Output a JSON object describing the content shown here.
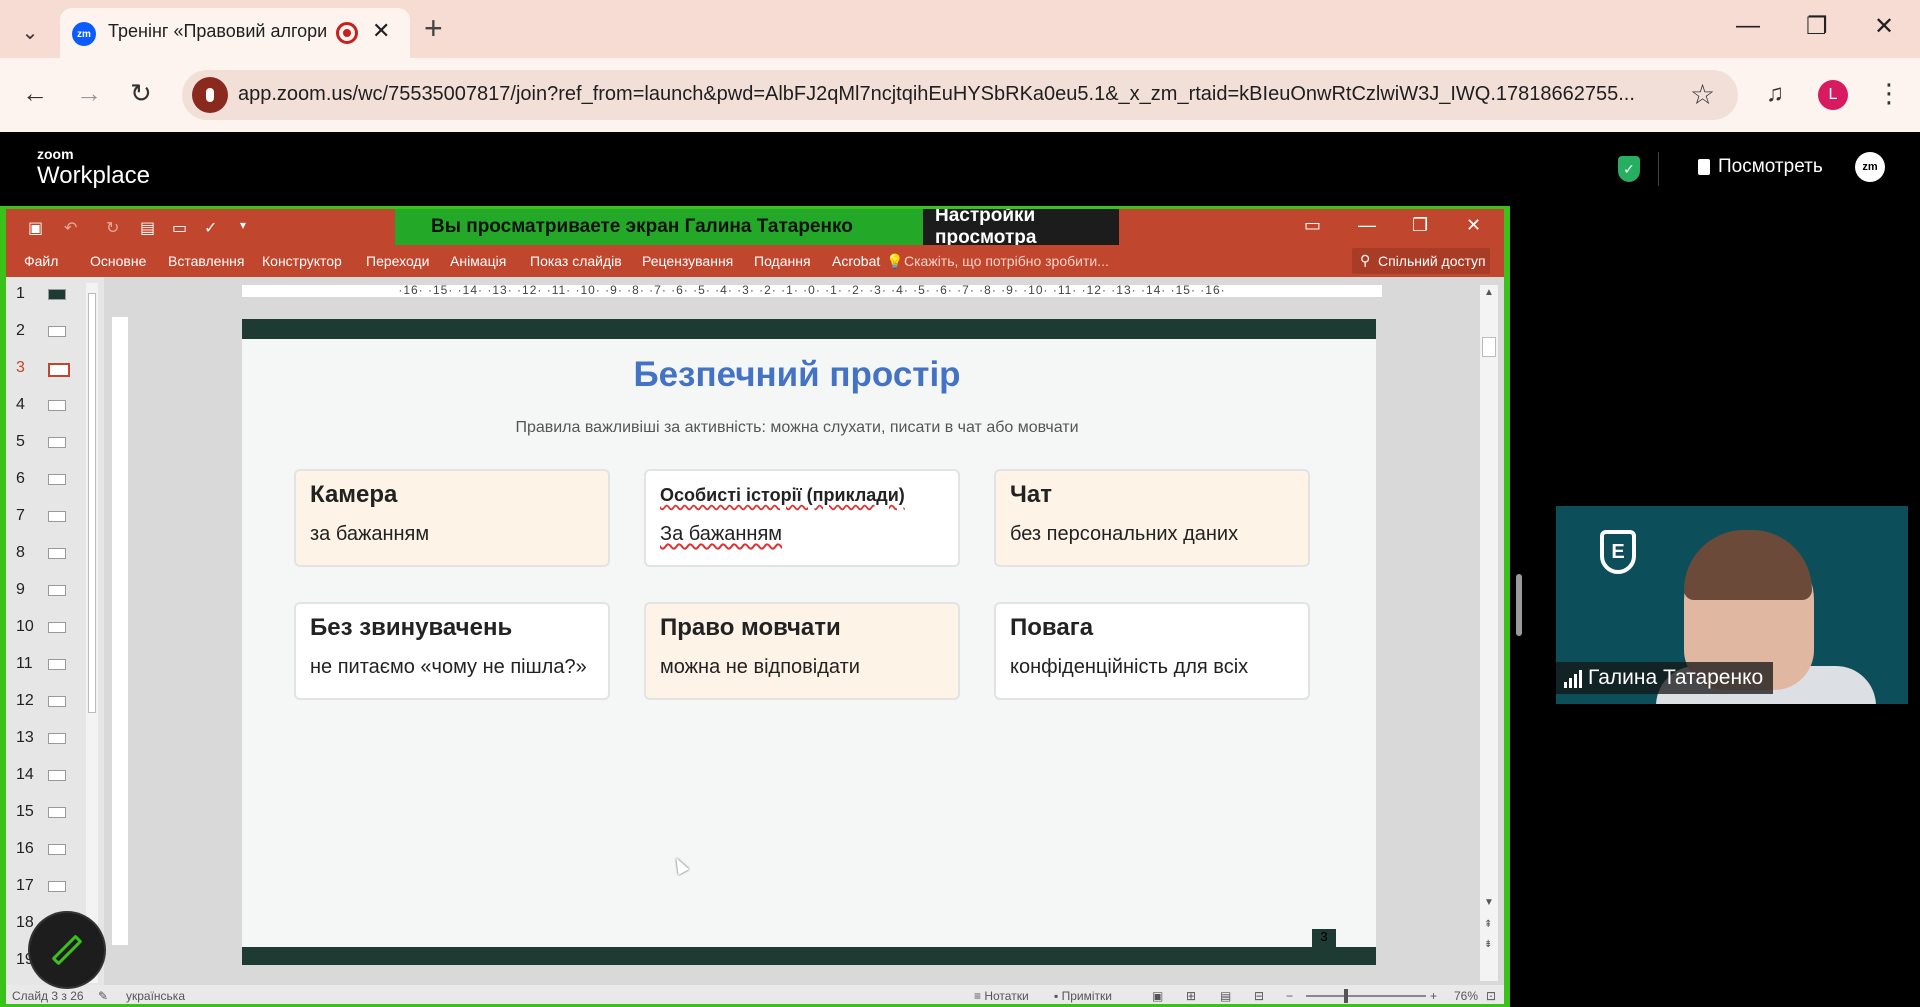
{
  "browser": {
    "tab_title": "Тренінг «Правовий алгори",
    "tab_favicon": "zm",
    "url": "app.zoom.us/wc/75535007817/join?ref_from=launch&pwd=AlbFJ2qMl7ncjtqihEuHYSbRKa0eu5.1&_x_zm_rtaid=kBIeuOnwRtCzlwiW3J_IWQ.17818662755...",
    "profile_initial": "L"
  },
  "zoom": {
    "logo_small": "zoom",
    "logo_big": "Workplace",
    "view_label": "Посмотреть",
    "badge": "zm"
  },
  "share": {
    "banner_text": "Вы просматриваете экран  Галина Татаренко",
    "banner_settings": "Настройки просмотра"
  },
  "ppt": {
    "menu": [
      "Файл",
      "Основне",
      "Вставлення",
      "Конструктор",
      "Переходи",
      "Анімація",
      "Показ слайдів",
      "Рецензування",
      "Подання",
      "Acrobat"
    ],
    "tell_me": "Скажіть, що потрібно зробити...",
    "share_access": "Спільний доступ",
    "thumbs": [
      "1",
      "2",
      "3",
      "4",
      "5",
      "6",
      "7",
      "8",
      "9",
      "10",
      "11",
      "12",
      "13",
      "14",
      "15",
      "16",
      "17",
      "18",
      "19"
    ],
    "active_slide": "3",
    "ruler": "·16· ·15· ·14· ·13· ·12· ·11· ·10· ·9· ·8· ·7· ·6· ·5· ·4· ·3· ·2· ·1· ·0· ·1· ·2· ·3· ·4· ·5· ·6· ·7· ·8· ·9· ·10· ·11· ·12· ·13· ·14· ·15· ·16·",
    "status": {
      "slide": "Слайд 3 з 26",
      "lang": "українська",
      "notes": "Нотатки",
      "comments": "Примітки",
      "zoom": "76%"
    }
  },
  "slide": {
    "title": "Безпечний простір",
    "subtitle": "Правила важливіші за активність: можна слухати, писати в чат або мовчати",
    "cards": [
      {
        "title": "Камера",
        "body": "за бажанням"
      },
      {
        "title": "Особисті історії (приклади)",
        "body": "За бажанням"
      },
      {
        "title": "Чат",
        "body": "без персональних даних"
      },
      {
        "title": "Без звинувачень",
        "body": "не питаємо «чому не пішла?»"
      },
      {
        "title": "Право мовчати",
        "body": "можна не відповідати"
      },
      {
        "title": "Повага",
        "body": "конфіденційність для всіх"
      }
    ],
    "page_number": "3"
  },
  "participant": {
    "name": "Галина Татаренко"
  },
  "colors": {
    "ppt_red": "#c0462e",
    "share_green": "#3ac21a",
    "slide_title": "#4472c4",
    "slide_band": "#1d3a33"
  }
}
